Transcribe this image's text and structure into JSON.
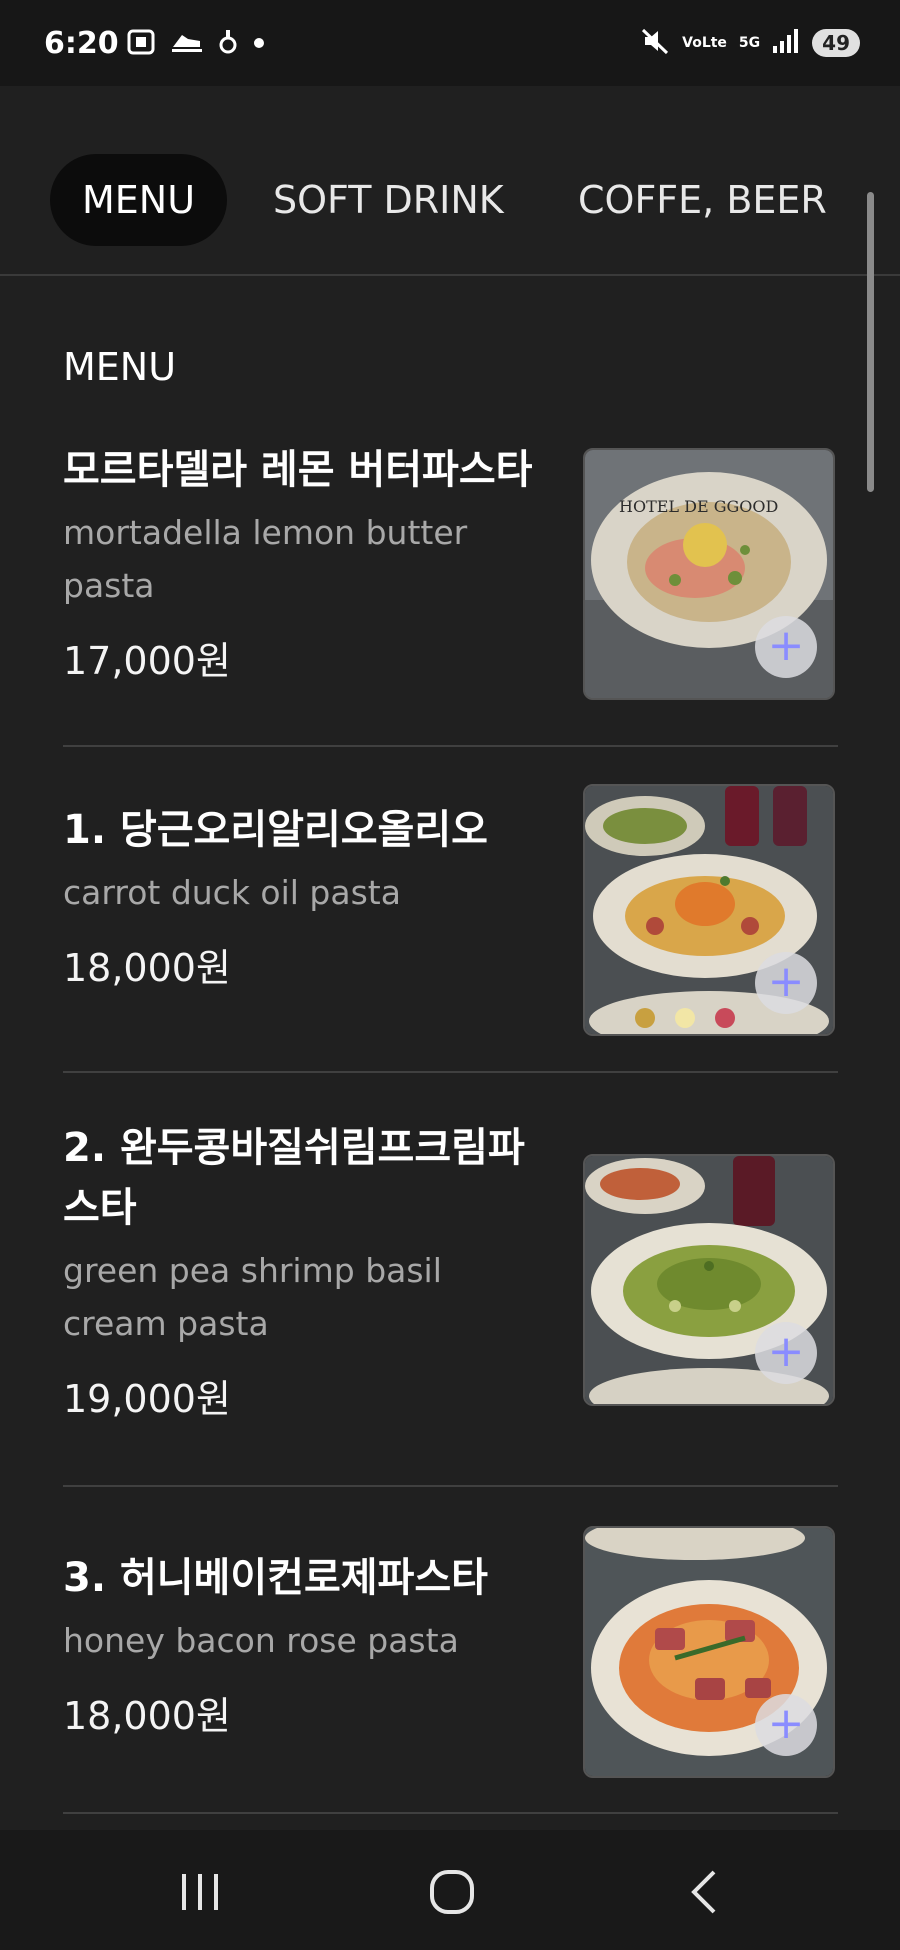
{
  "status_bar": {
    "time": "6:20",
    "left_icons": [
      "screenshot-icon",
      "shoe-icon",
      "notification-icon",
      "dot-icon"
    ],
    "right_icons": [
      "mute-icon",
      "volte-icon",
      "5g-icon",
      "signal-icon"
    ],
    "volte_label": "VoLte",
    "network_label": "5G",
    "battery": "49"
  },
  "tabs": [
    {
      "label": "MENU",
      "active": true
    },
    {
      "label": "SOFT DRINK",
      "active": false
    },
    {
      "label": "COFFE, BEER",
      "active": false
    }
  ],
  "section_title": "MENU",
  "items": [
    {
      "name": "모르타델라 레몬 버터파스타",
      "desc": "mortadella lemon butter pasta",
      "price": "17,000원",
      "image": "pasta-lemon-image"
    },
    {
      "name": "1. 당근오리알리오올리오",
      "desc": "carrot duck oil pasta",
      "price": "18,000원",
      "image": "pasta-carrot-image"
    },
    {
      "name": "2. 완두콩바질쉬림프크림파스타",
      "desc": "green pea shrimp basil cream pasta",
      "price": "19,000원",
      "image": "pasta-pea-image"
    },
    {
      "name": "3. 허니베이컨로제파스타",
      "desc": "honey bacon rose pasta",
      "price": "18,000원",
      "image": "pasta-rose-image"
    }
  ],
  "plus_glyph": "+",
  "plate_text": "HOTEL DE GGOOD",
  "nav": [
    "recent-apps-icon",
    "home-icon",
    "back-icon"
  ]
}
